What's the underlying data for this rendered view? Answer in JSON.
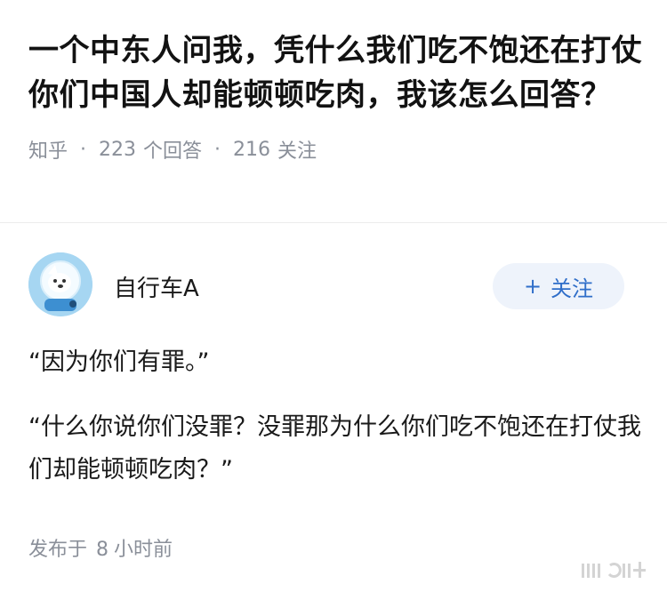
{
  "question": {
    "title": "一个中东人问我，凭什么我们吃不饱还在打仗你们中国人却能顿顿吃肉，我该怎么回答？",
    "source": "知乎",
    "answers_count": "223",
    "answers_label": "个回答",
    "followers_count": "216",
    "followers_label": "关注"
  },
  "author": {
    "name": "自行车A",
    "follow_label": "关注",
    "follow_icon": "plus-icon",
    "avatar_icon": "dog-astronaut-avatar"
  },
  "answer": {
    "paragraphs": [
      "“因为你们有罪。”",
      "“什么你说你们没罪？没罪那为什么你们吃不饱还在打仗我们却能顿顿吃肉？”"
    ]
  },
  "footer": {
    "posted_label": "发布于",
    "posted_value": "8",
    "posted_unit": "小时前"
  },
  "colors": {
    "title": "#121212",
    "meta": "#8a8f99",
    "follow_bg": "#eef3fb",
    "follow_text": "#2f6ec9",
    "avatar_bg": "#a6d6f2"
  }
}
